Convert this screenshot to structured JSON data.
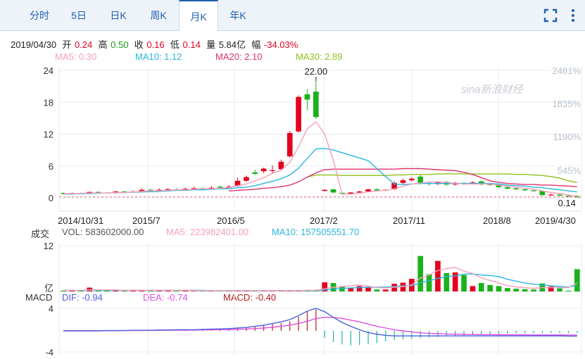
{
  "tabs": [
    {
      "label": "分时",
      "active": false
    },
    {
      "label": "5日",
      "active": false
    },
    {
      "label": "日K",
      "active": false
    },
    {
      "label": "周K",
      "active": false
    },
    {
      "label": "月K",
      "active": true
    },
    {
      "label": "年K",
      "active": false
    }
  ],
  "toolbar": {
    "fullscreen_icon": "fullscreen-icon",
    "more_icon": "more-vertical-icon"
  },
  "info": {
    "date": "2019/04/30",
    "open_label": "开",
    "open": "0.24",
    "high_label": "高",
    "high": "0.50",
    "close_label": "收",
    "close": "0.16",
    "low_label": "低",
    "low": "0.14",
    "volume_label": "量",
    "volume": "5.84亿",
    "change_label": "幅",
    "change": "-34.03%"
  },
  "ma_legend": {
    "ma5": "MA5: 0.30",
    "ma10": "MA10: 1.12",
    "ma20": "MA20: 2.10",
    "ma30": "MA30: 2.89"
  },
  "colors": {
    "up": "#e4001f",
    "down": "#1ab21a",
    "ma5": "#f5a0b8",
    "ma10": "#27b6e0",
    "ma20": "#e0336e",
    "ma30": "#8ec21a",
    "dif": "#4c5fe0",
    "dea": "#e14fe0"
  },
  "watermark": "sina新浪财经",
  "price_chart": {
    "y_ticks": [
      "24",
      "18",
      "12",
      "6",
      "0"
    ],
    "pct_ticks": [
      "2481%",
      "1835%",
      "1190%",
      "545%"
    ],
    "x_labels": [
      "2014/10/31",
      "2015/7",
      "2016/5",
      "2017/2",
      "2017/11",
      "2018/8",
      "2019/4/30"
    ],
    "high_label": "22.00",
    "low_label": "0.14"
  },
  "volume_panel": {
    "title": "成交",
    "vol": "VOL: 583602000.00",
    "ma5": "MA5: 223982401.00",
    "ma10": "MA10: 157505551.70",
    "y_top": "12",
    "y_unit": "亿"
  },
  "macd_panel": {
    "title": "MACD",
    "dif": "DIF: -0.94",
    "dea": "DEA: -0.74",
    "macd": "MACD: -0.40",
    "y_top": "4",
    "y_bottom": "-4"
  },
  "chart_data": {
    "type": "candlestick",
    "y_range": [
      0,
      24
    ],
    "candles": [
      {
        "o": 0.9,
        "c": 0.7,
        "h": 1.0,
        "l": 0.6
      },
      {
        "o": 0.8,
        "c": 0.9,
        "h": 1.0,
        "l": 0.7
      },
      {
        "o": 0.9,
        "c": 0.8,
        "h": 1.0,
        "l": 0.7
      },
      {
        "o": 0.8,
        "c": 1.1,
        "h": 1.2,
        "l": 0.7
      },
      {
        "o": 1.1,
        "c": 1.0,
        "h": 1.2,
        "l": 0.9
      },
      {
        "o": 1.0,
        "c": 0.9,
        "h": 1.1,
        "l": 0.8
      },
      {
        "o": 0.9,
        "c": 1.2,
        "h": 1.3,
        "l": 0.8
      },
      {
        "o": 1.2,
        "c": 1.1,
        "h": 1.3,
        "l": 1.0
      },
      {
        "o": 1.1,
        "c": 1.2,
        "h": 1.4,
        "l": 1.0
      },
      {
        "o": 1.2,
        "c": 1.5,
        "h": 1.8,
        "l": 1.1
      },
      {
        "o": 1.5,
        "c": 1.4,
        "h": 1.7,
        "l": 1.2
      },
      {
        "o": 1.4,
        "c": 1.5,
        "h": 1.8,
        "l": 1.3
      },
      {
        "o": 1.5,
        "c": 1.6,
        "h": 1.9,
        "l": 1.4
      },
      {
        "o": 1.6,
        "c": 1.5,
        "h": 1.8,
        "l": 1.4
      },
      {
        "o": 1.5,
        "c": 1.7,
        "h": 1.9,
        "l": 1.4
      },
      {
        "o": 1.7,
        "c": 1.8,
        "h": 2.1,
        "l": 1.6
      },
      {
        "o": 1.8,
        "c": 1.7,
        "h": 2.0,
        "l": 1.6
      },
      {
        "o": 1.7,
        "c": 1.9,
        "h": 2.2,
        "l": 1.6
      },
      {
        "o": 2.1,
        "c": 1.9,
        "h": 2.3,
        "l": 1.8
      },
      {
        "o": 1.9,
        "c": 2.1,
        "h": 2.4,
        "l": 1.8
      },
      {
        "o": 2.2,
        "c": 3.2,
        "h": 3.8,
        "l": 2.1
      },
      {
        "o": 3.2,
        "c": 3.9,
        "h": 4.2,
        "l": 3.0
      },
      {
        "o": 4.8,
        "c": 4.5,
        "h": 5.3,
        "l": 4.3
      },
      {
        "o": 5.0,
        "c": 5.5,
        "h": 5.7,
        "l": 4.6
      },
      {
        "o": 5.1,
        "c": 5.2,
        "h": 6.1,
        "l": 4.5
      },
      {
        "o": 5.4,
        "c": 6.8,
        "h": 7.2,
        "l": 5.1
      },
      {
        "o": 7.8,
        "c": 12.2,
        "h": 12.6,
        "l": 7.6
      },
      {
        "o": 12.5,
        "c": 19.0,
        "h": 19.3,
        "l": 12.3
      },
      {
        "o": 19.5,
        "c": 18.5,
        "h": 20.5,
        "l": 16.5
      },
      {
        "o": 20.0,
        "c": 15.2,
        "h": 22.0,
        "l": 14.9
      },
      {
        "o": 1.3,
        "c": 1.5,
        "h": 1.6,
        "l": 1.2
      },
      {
        "o": 1.6,
        "c": 1.0,
        "h": 1.7,
        "l": 0.9
      },
      {
        "o": 0.95,
        "c": 0.8,
        "h": 1.0,
        "l": 0.6
      },
      {
        "o": 0.8,
        "c": 1.0,
        "h": 1.1,
        "l": 0.7
      },
      {
        "o": 1.0,
        "c": 1.2,
        "h": 1.3,
        "l": 0.9
      },
      {
        "o": 1.2,
        "c": 1.6,
        "h": 1.7,
        "l": 1.1
      },
      {
        "o": 1.6,
        "c": 1.4,
        "h": 1.8,
        "l": 1.3
      },
      {
        "o": 1.4,
        "c": 1.5,
        "h": 1.6,
        "l": 1.3
      },
      {
        "o": 1.6,
        "c": 2.8,
        "h": 3.1,
        "l": 1.5
      },
      {
        "o": 2.8,
        "c": 3.3,
        "h": 3.6,
        "l": 2.6
      },
      {
        "o": 3.3,
        "c": 3.6,
        "h": 3.9,
        "l": 3.1
      },
      {
        "o": 4.0,
        "c": 2.7,
        "h": 4.3,
        "l": 2.5
      },
      {
        "o": 2.8,
        "c": 2.6,
        "h": 2.9,
        "l": 2.3
      },
      {
        "o": 2.6,
        "c": 2.9,
        "h": 3.1,
        "l": 2.4
      },
      {
        "o": 3.0,
        "c": 2.5,
        "h": 3.2,
        "l": 2.3
      },
      {
        "o": 2.5,
        "c": 2.8,
        "h": 3.0,
        "l": 2.3
      },
      {
        "o": 2.8,
        "c": 2.6,
        "h": 3.0,
        "l": 2.4
      },
      {
        "o": 2.6,
        "c": 2.9,
        "h": 3.1,
        "l": 2.5
      },
      {
        "o": 3.1,
        "c": 2.5,
        "h": 3.3,
        "l": 2.3
      },
      {
        "o": 2.6,
        "c": 2.4,
        "h": 2.8,
        "l": 2.2
      },
      {
        "o": 2.4,
        "c": 2.0,
        "h": 2.6,
        "l": 1.8
      },
      {
        "o": 2.0,
        "c": 1.7,
        "h": 2.2,
        "l": 1.6
      },
      {
        "o": 1.8,
        "c": 1.6,
        "h": 2.0,
        "l": 1.5
      },
      {
        "o": 1.6,
        "c": 1.4,
        "h": 1.8,
        "l": 1.3
      },
      {
        "o": 1.4,
        "c": 1.3,
        "h": 1.6,
        "l": 1.2
      },
      {
        "o": 1.3,
        "c": 0.5,
        "h": 1.4,
        "l": 0.4
      },
      {
        "o": 0.5,
        "c": 0.6,
        "h": 0.8,
        "l": 0.4
      },
      {
        "o": 0.6,
        "c": 0.4,
        "h": 0.7,
        "l": 0.3
      },
      {
        "o": 0.4,
        "c": 0.24,
        "h": 0.5,
        "l": 0.2
      },
      {
        "o": 0.24,
        "c": 0.16,
        "h": 0.5,
        "l": 0.14
      }
    ],
    "ma5": [
      0.8,
      0.8,
      0.8,
      0.9,
      0.9,
      0.9,
      1.0,
      1.0,
      1.1,
      1.2,
      1.3,
      1.3,
      1.4,
      1.5,
      1.5,
      1.6,
      1.7,
      1.7,
      1.8,
      1.9,
      2.3,
      2.6,
      3.2,
      3.8,
      4.6,
      5.2,
      6.7,
      9.6,
      13.0,
      14.3,
      12.0,
      7.0,
      0.7,
      0.7,
      0.9,
      1.1,
      1.3,
      1.4,
      1.7,
      2.2,
      2.6,
      2.8,
      3.0,
      3.0,
      2.9,
      2.7,
      2.6,
      2.6,
      2.6,
      2.6,
      2.4,
      2.2,
      2.0,
      1.8,
      1.6,
      1.3,
      1.0,
      0.8,
      0.5,
      0.3
    ],
    "ma10": [
      0.7,
      0.7,
      0.75,
      0.8,
      0.85,
      0.9,
      0.95,
      1.0,
      1.05,
      1.1,
      1.15,
      1.2,
      1.3,
      1.4,
      1.4,
      1.5,
      1.5,
      1.6,
      1.7,
      1.7,
      1.9,
      2.0,
      2.3,
      2.7,
      3.1,
      3.6,
      4.3,
      5.6,
      7.4,
      9.2,
      9.3,
      9.0,
      8.5,
      8.0,
      7.5,
      7.0,
      5.5,
      4.0,
      2.6,
      2.5,
      2.6,
      2.7,
      2.7,
      2.7,
      2.7,
      2.7,
      2.7,
      2.7,
      2.7,
      2.7,
      2.6,
      2.4,
      2.3,
      2.2,
      2.0,
      1.9,
      1.7,
      1.5,
      1.3,
      1.12
    ],
    "ma20": [
      null,
      null,
      null,
      null,
      null,
      null,
      null,
      null,
      null,
      null,
      null,
      null,
      null,
      null,
      null,
      null,
      null,
      null,
      null,
      1.3,
      1.4,
      1.5,
      1.6,
      1.8,
      1.9,
      2.1,
      2.4,
      3.0,
      3.9,
      4.7,
      5.3,
      5.4,
      5.4,
      5.4,
      5.4,
      5.4,
      5.4,
      5.4,
      5.4,
      5.5,
      5.5,
      5.5,
      5.4,
      5.3,
      5.2,
      5.1,
      4.8,
      4.4,
      3.8,
      3.2,
      2.9,
      2.7,
      2.6,
      2.5,
      2.5,
      2.4,
      2.4,
      2.3,
      2.2,
      2.1
    ],
    "ma30": [
      null,
      null,
      null,
      null,
      null,
      null,
      null,
      null,
      null,
      null,
      null,
      null,
      null,
      null,
      null,
      null,
      null,
      null,
      null,
      null,
      null,
      null,
      null,
      null,
      null,
      null,
      null,
      null,
      3.9,
      4.3,
      4.3,
      4.3,
      4.2,
      4.2,
      4.2,
      4.2,
      4.2,
      4.2,
      4.3,
      4.3,
      4.4,
      4.4,
      4.4,
      4.5,
      4.5,
      4.5,
      4.5,
      4.5,
      4.5,
      4.5,
      4.5,
      4.5,
      4.4,
      4.4,
      4.3,
      4.2,
      4.0,
      3.7,
      3.2,
      2.89
    ],
    "volume": [
      0.2,
      0.3,
      0.2,
      1.0,
      0.2,
      0.2,
      0.3,
      0.2,
      0.3,
      0.3,
      0.2,
      0.2,
      0.3,
      0.2,
      0.2,
      0.2,
      0.2,
      0.2,
      0.2,
      0.2,
      0.3,
      0.3,
      0.2,
      0.2,
      0.2,
      0.3,
      0.3,
      0.3,
      0.3,
      0.4,
      2.4,
      2.2,
      1.3,
      1.0,
      1.4,
      1.0,
      0.5,
      0.5,
      2.0,
      2.3,
      3.3,
      9.3,
      4.5,
      8.0,
      4.8,
      5.0,
      4.3,
      1.4,
      2.2,
      1.7,
      1.4,
      0.9,
      0.7,
      0.6,
      0.5,
      2.1,
      1.3,
      0.8,
      0.2,
      5.84
    ],
    "vol_ma5": [
      0.3,
      0.3,
      0.3,
      0.4,
      0.4,
      0.4,
      0.4,
      0.3,
      0.3,
      0.3,
      0.3,
      0.3,
      0.3,
      0.3,
      0.3,
      0.2,
      0.2,
      0.2,
      0.2,
      0.2,
      0.2,
      0.2,
      0.2,
      0.2,
      0.2,
      0.2,
      0.2,
      0.2,
      0.3,
      0.3,
      0.7,
      1.1,
      1.3,
      1.5,
      1.7,
      1.4,
      1.0,
      0.9,
      1.1,
      1.3,
      1.7,
      3.5,
      4.3,
      5.5,
      6.0,
      6.3,
      5.3,
      4.7,
      3.5,
      2.9,
      2.2,
      1.5,
      1.2,
      1.0,
      0.8,
      1.0,
      1.0,
      1.0,
      1.0,
      2.24
    ],
    "vol_ma10": [
      0.3,
      0.3,
      0.3,
      0.3,
      0.3,
      0.3,
      0.3,
      0.3,
      0.3,
      0.3,
      0.3,
      0.3,
      0.3,
      0.3,
      0.3,
      0.3,
      0.3,
      0.2,
      0.2,
      0.2,
      0.2,
      0.2,
      0.2,
      0.2,
      0.2,
      0.2,
      0.2,
      0.2,
      0.2,
      0.2,
      0.4,
      0.6,
      0.8,
      0.9,
      1.0,
      1.1,
      1.1,
      1.1,
      1.3,
      1.5,
      1.5,
      2.3,
      2.8,
      3.4,
      3.9,
      4.1,
      4.5,
      4.6,
      4.3,
      4.2,
      3.9,
      3.2,
      2.7,
      2.2,
      1.9,
      1.7,
      1.5,
      1.3,
      1.1,
      1.58
    ],
    "macd_hist": [
      0.05,
      0.05,
      0.05,
      0.1,
      0.05,
      0.05,
      0.1,
      0.1,
      0.1,
      0.1,
      0.15,
      0.15,
      0.2,
      0.2,
      0.2,
      0.25,
      0.25,
      0.3,
      0.35,
      0.4,
      0.5,
      0.6,
      0.8,
      1.0,
      1.2,
      1.4,
      1.7,
      2.5,
      3.5,
      3.8,
      -1.2,
      -2.0,
      -2.4,
      -2.6,
      -2.5,
      -2.4,
      -2.2,
      -1.9,
      -1.6,
      -1.5,
      -1.4,
      -1.3,
      -1.2,
      -1.1,
      -1.0,
      -0.9,
      -0.8,
      -0.7,
      -0.65,
      -0.6,
      -0.55,
      -0.5,
      -0.48,
      -0.45,
      -0.43,
      -0.42,
      -0.41,
      -0.4,
      -0.4,
      -0.4
    ],
    "dif": [
      0.0,
      0.0,
      0.0,
      0.0,
      0.0,
      0.05,
      0.05,
      0.05,
      0.1,
      0.1,
      0.1,
      0.15,
      0.15,
      0.2,
      0.2,
      0.2,
      0.25,
      0.3,
      0.35,
      0.4,
      0.5,
      0.6,
      0.8,
      1.0,
      1.3,
      1.6,
      2.0,
      2.7,
      3.5,
      4.0,
      3.4,
      2.4,
      1.5,
      0.8,
      0.2,
      -0.3,
      -0.6,
      -0.8,
      -0.9,
      -0.9,
      -0.9,
      -0.9,
      -0.9,
      -0.9,
      -0.9,
      -0.9,
      -0.9,
      -0.9,
      -0.9,
      -0.9,
      -0.9,
      -0.9,
      -0.9,
      -0.9,
      -0.9,
      -0.9,
      -0.9,
      -0.9,
      -0.92,
      -0.94
    ],
    "dea": [
      0.0,
      0.0,
      0.0,
      0.0,
      0.0,
      0.02,
      0.03,
      0.04,
      0.05,
      0.06,
      0.07,
      0.09,
      0.1,
      0.12,
      0.13,
      0.14,
      0.16,
      0.18,
      0.2,
      0.23,
      0.27,
      0.32,
      0.4,
      0.5,
      0.63,
      0.8,
      1.0,
      1.3,
      1.7,
      2.2,
      2.4,
      2.4,
      2.2,
      1.9,
      1.6,
      1.2,
      0.8,
      0.5,
      0.2,
      0.0,
      -0.2,
      -0.35,
      -0.45,
      -0.5,
      -0.55,
      -0.6,
      -0.62,
      -0.65,
      -0.67,
      -0.68,
      -0.69,
      -0.7,
      -0.71,
      -0.71,
      -0.72,
      -0.72,
      -0.73,
      -0.73,
      -0.74,
      -0.74
    ]
  }
}
